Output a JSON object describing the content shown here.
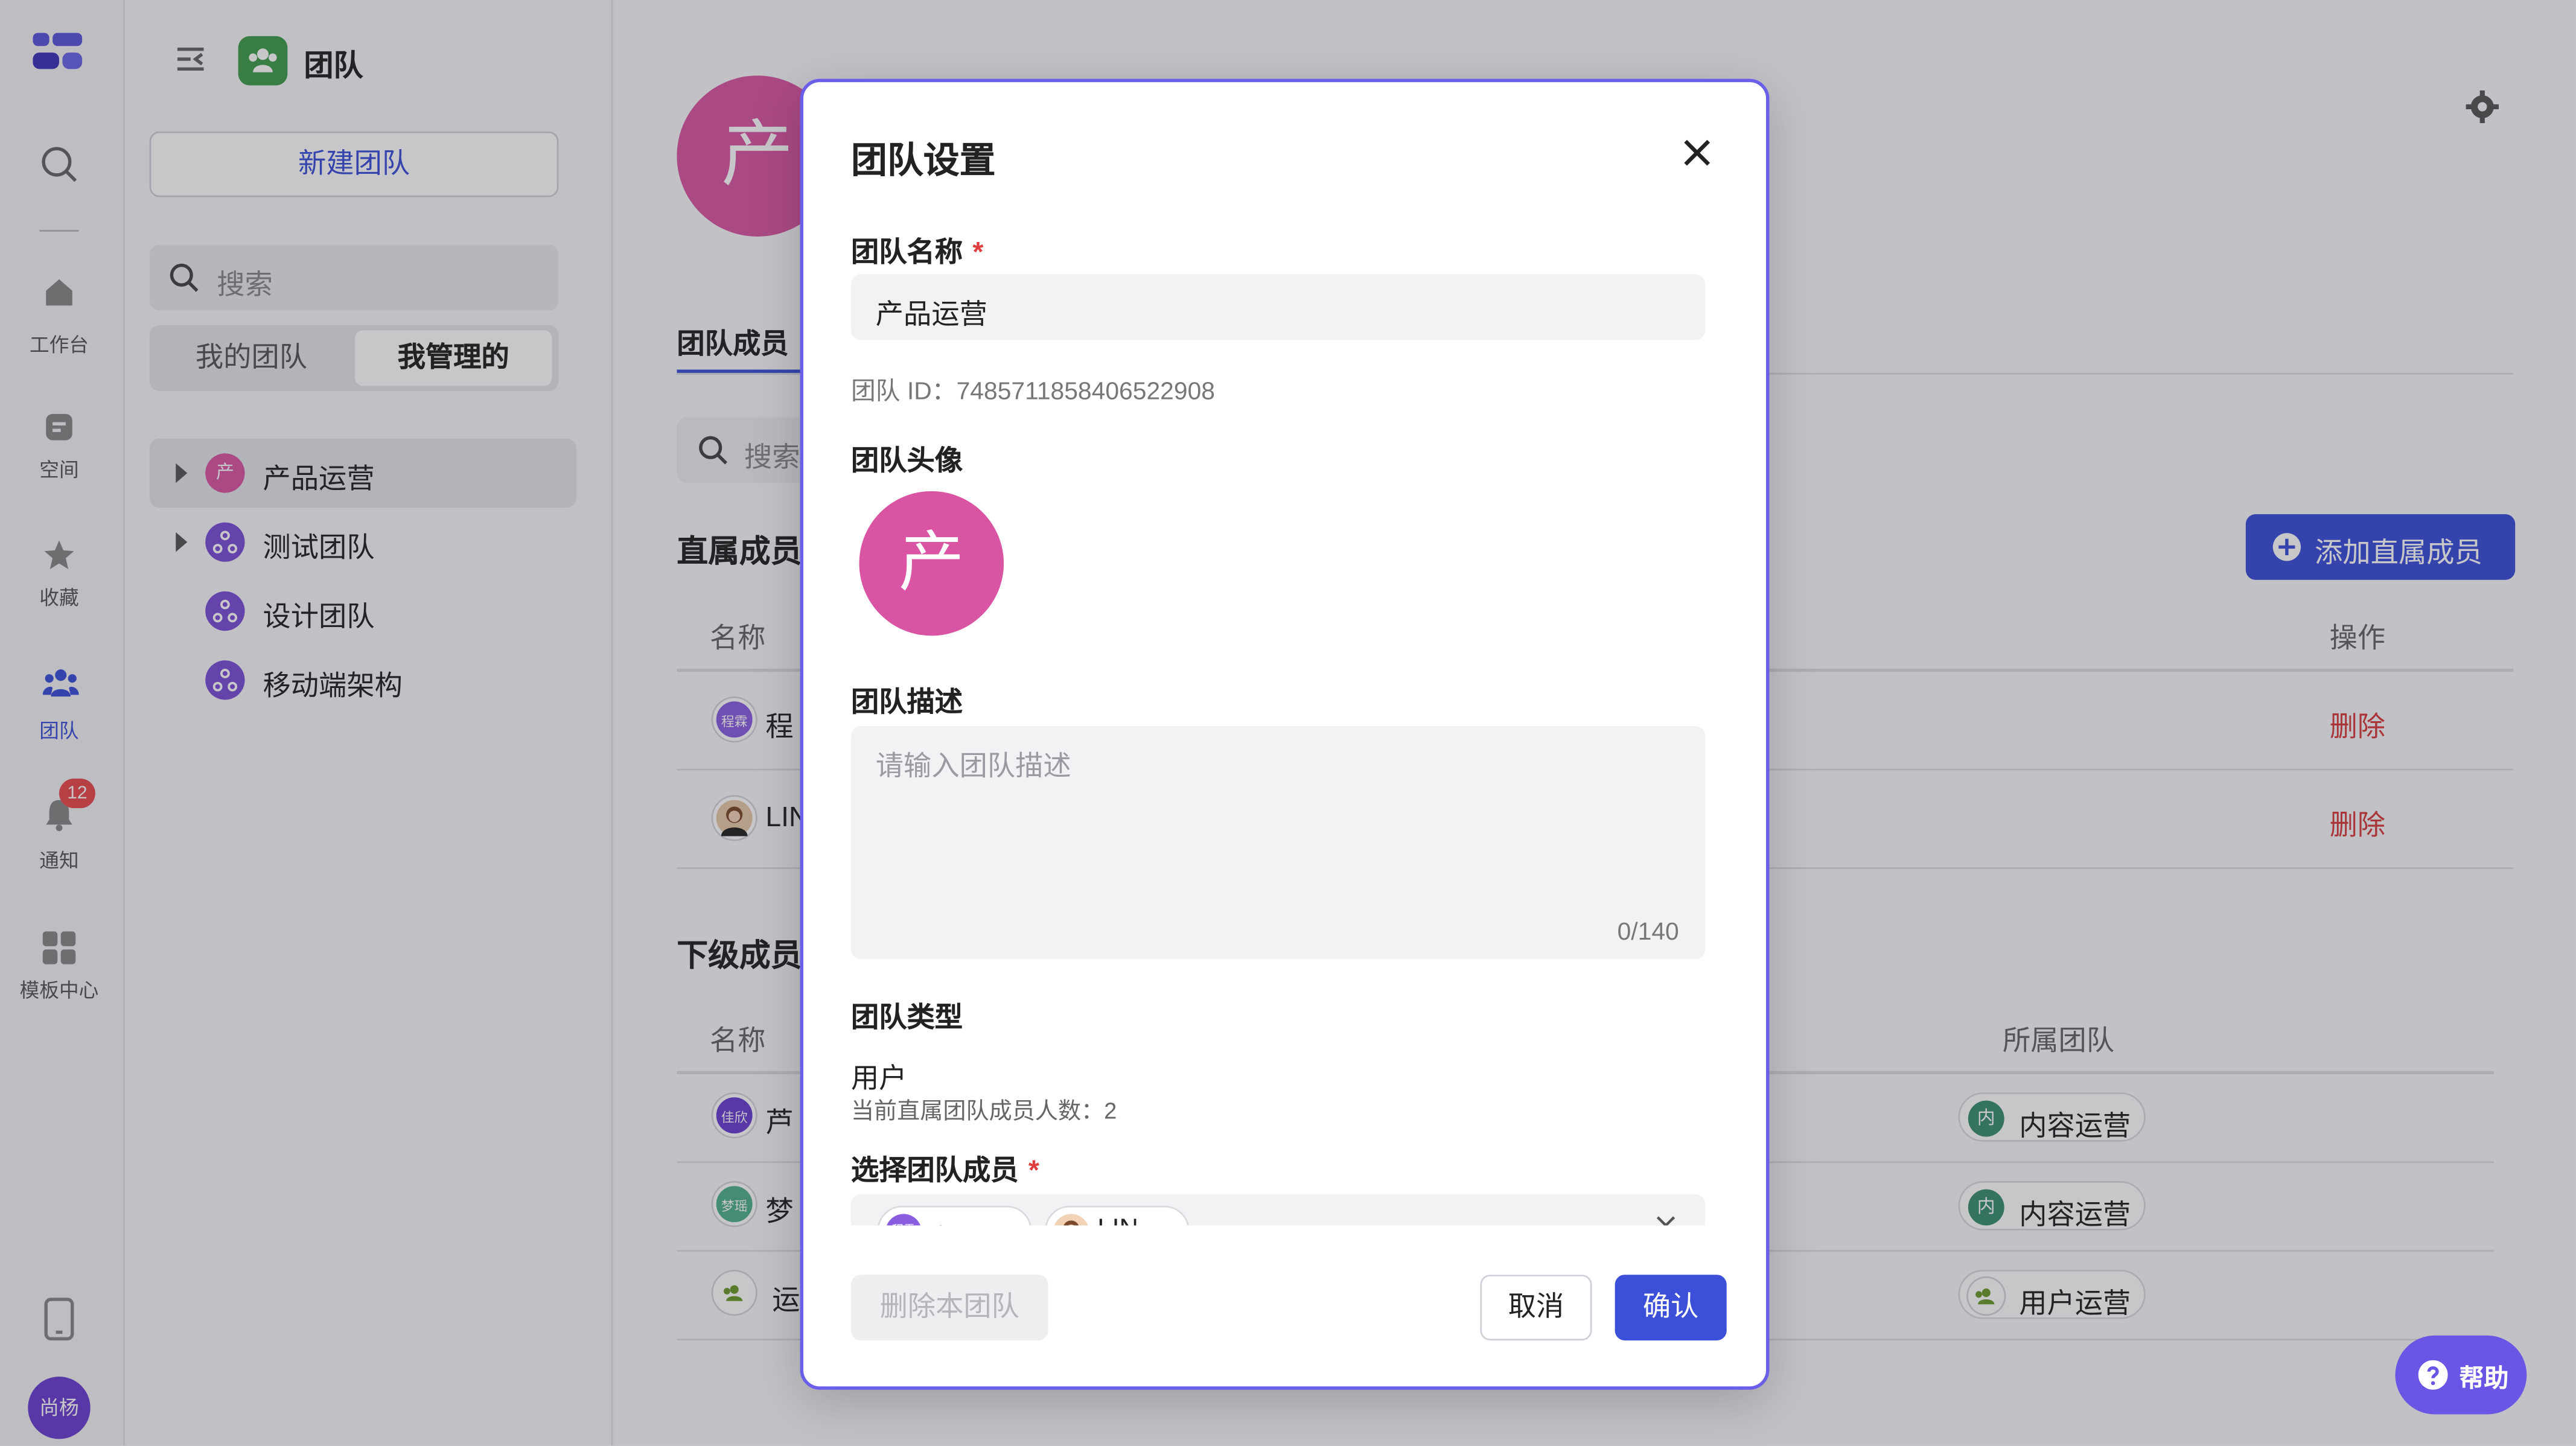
{
  "rail": {
    "items": [
      {
        "label": "工作台",
        "icon": "home-icon"
      },
      {
        "label": "空间",
        "icon": "space-icon"
      },
      {
        "label": "收藏",
        "icon": "star-icon"
      },
      {
        "label": "团队",
        "icon": "team-icon"
      },
      {
        "label": "通知",
        "icon": "bell-icon",
        "badge": "12"
      },
      {
        "label": "模板中心",
        "icon": "template-icon"
      }
    ],
    "user_avatar": "尚杨"
  },
  "team_panel": {
    "title": "团队",
    "new_team_button": "新建团队",
    "search_placeholder": "搜索",
    "tabs": [
      "我的团队",
      "我管理的"
    ],
    "teams": [
      {
        "name": "产品运营",
        "avatar": "产"
      },
      {
        "name": "测试团队"
      },
      {
        "name": "设计团队"
      },
      {
        "name": "移动端架构"
      }
    ]
  },
  "main": {
    "team_avatar": "产",
    "tab_members": "团队成员",
    "search_placeholder": "搜索",
    "direct_section": "直属成员",
    "add_direct_button": "添加直属成员",
    "col_name": "名称",
    "col_action": "操作",
    "direct_members": [
      {
        "name": "程",
        "avatar": "程霖",
        "action": "删除"
      },
      {
        "name": "LIN",
        "action": "删除"
      }
    ],
    "sub_section": "下级成员",
    "col_team": "所属团队",
    "sub_members": [
      {
        "name": "芦",
        "avatar": "佳欣",
        "team_icon": "内",
        "team": "内容运营"
      },
      {
        "name": "梦",
        "avatar": "梦瑶",
        "team_icon": "内",
        "team": "内容运营"
      },
      {
        "name": "运",
        "team": "用户运营"
      }
    ]
  },
  "modal": {
    "title": "团队设置",
    "name_label": "团队名称",
    "name_value": "产品运营",
    "team_id": "团队 ID：7485711858406522908",
    "avatar_label": "团队头像",
    "avatar_char": "产",
    "desc_label": "团队描述",
    "desc_placeholder": "请输入团队描述",
    "desc_counter": "0/140",
    "type_label": "团队类型",
    "type_value": "用户",
    "member_count": "当前直属团队成员人数：2",
    "select_label": "选择团队成员",
    "selected": [
      {
        "name": "程霖",
        "avatar": "程霖"
      },
      {
        "name": "LIN"
      }
    ],
    "delete_button": "删除本团队",
    "cancel_button": "取消",
    "confirm_button": "确认"
  },
  "help_button": "帮助",
  "colors": {
    "accent": "#3b4fd8",
    "pink": "#d955a3",
    "purple": "#7a4fd6",
    "danger": "#d83b3b"
  }
}
